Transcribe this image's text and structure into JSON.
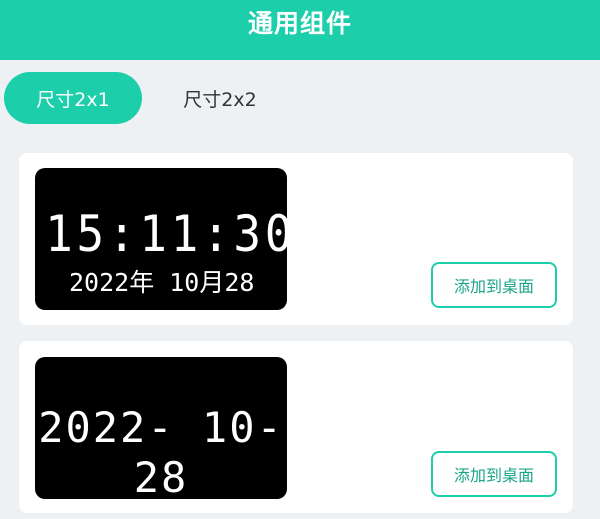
{
  "header": {
    "title": "通用组件"
  },
  "tabs": [
    {
      "label": "尺寸2x1",
      "active": true
    },
    {
      "label": "尺寸2x2",
      "active": false
    }
  ],
  "widgets": [
    {
      "time": "15:11:30",
      "date": "2022年 10月28",
      "button_label": "添加到桌面"
    },
    {
      "date": "2022- 10-28",
      "button_label": "添加到桌面"
    }
  ],
  "colors": {
    "accent": "#1ccfaa",
    "background": "#eef1f4",
    "clock_bg": "#000000"
  }
}
